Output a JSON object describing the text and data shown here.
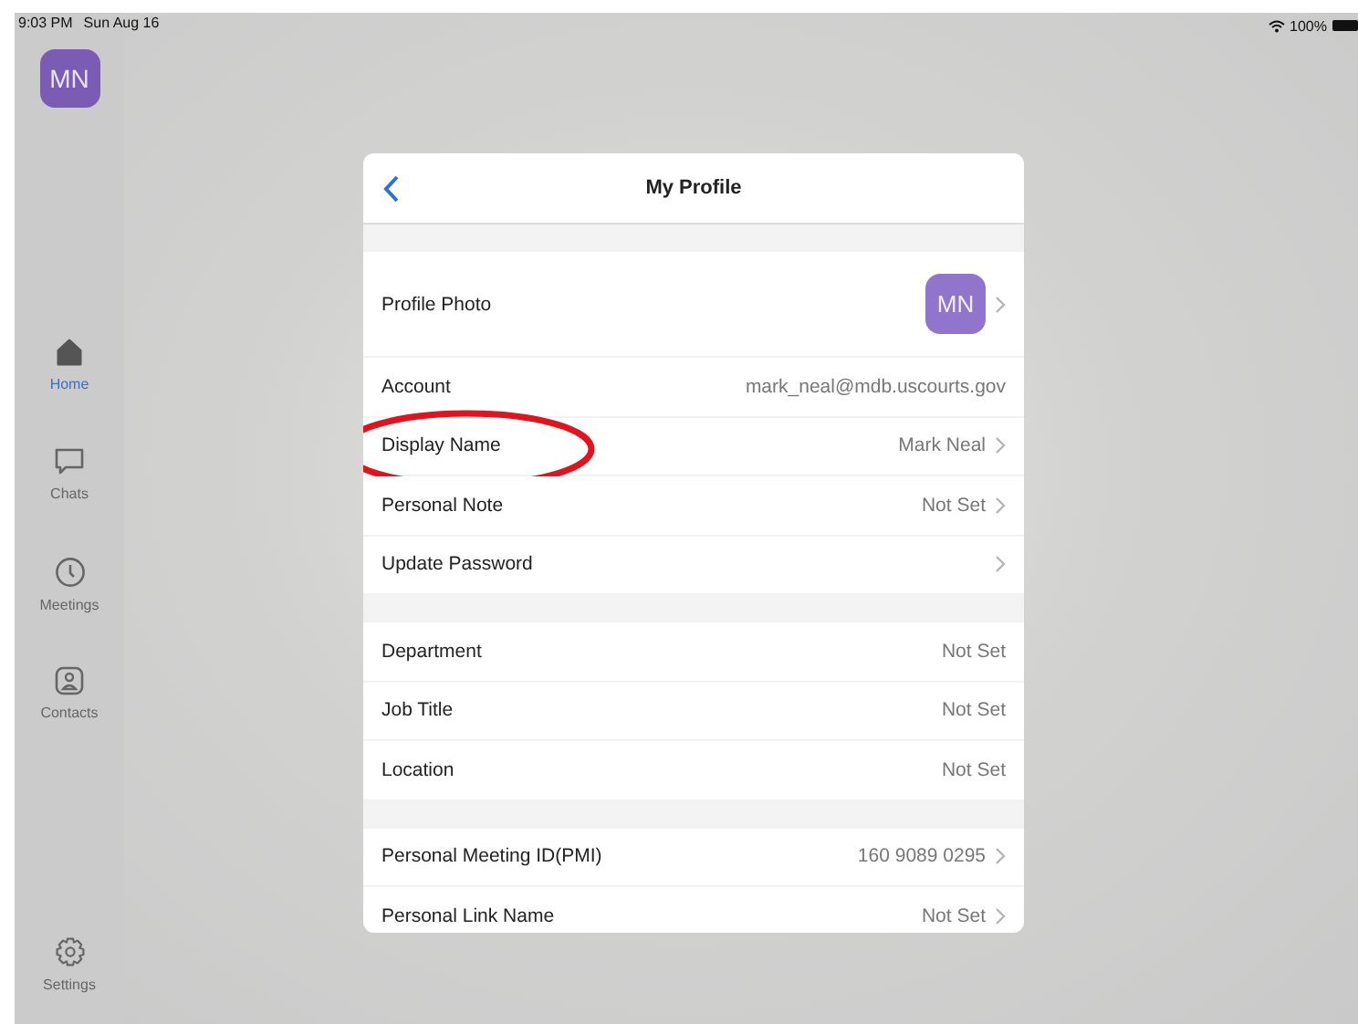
{
  "status_bar": {
    "time": "9:03 PM",
    "date": "Sun Aug 16",
    "battery": "100%"
  },
  "sidebar": {
    "avatar": "MN",
    "items": [
      {
        "label": "Home",
        "selected": true
      },
      {
        "label": "Chats",
        "selected": false
      },
      {
        "label": "Meetings",
        "selected": false
      },
      {
        "label": "Contacts",
        "selected": false
      }
    ],
    "settings": {
      "label": "Settings",
      "selected": false
    }
  },
  "dialog": {
    "title": "My Profile",
    "sections": [
      {
        "rows": [
          {
            "label": "Profile Photo",
            "kind": "avatar",
            "value": "MN",
            "chevron": true,
            "circled": false
          },
          {
            "label": "Account",
            "kind": "text",
            "value": "mark_neal@mdb.uscourts.gov",
            "chevron": false,
            "circled": false
          },
          {
            "label": "Display Name",
            "kind": "text",
            "value": "Mark Neal",
            "chevron": true,
            "circled": true
          },
          {
            "label": "Personal Note",
            "kind": "text",
            "value": "Not Set",
            "chevron": true,
            "circled": false
          },
          {
            "label": "Update Password",
            "kind": "text",
            "chevron": true,
            "circled": false
          }
        ]
      },
      {
        "rows": [
          {
            "label": "Department",
            "kind": "text",
            "value": "Not Set",
            "chevron": false,
            "circled": false
          },
          {
            "label": "Job Title",
            "kind": "text",
            "value": "Not Set",
            "chevron": false,
            "circled": false
          },
          {
            "label": "Location",
            "kind": "text",
            "value": "Not Set",
            "chevron": false,
            "circled": false
          }
        ]
      },
      {
        "rows": [
          {
            "label": "Personal Meeting ID(PMI)",
            "kind": "text",
            "value": "160 9089 0295",
            "chevron": true,
            "circled": false
          },
          {
            "label": "Personal Link Name",
            "kind": "text",
            "value": "Not Set",
            "chevron": true,
            "circled": false
          }
        ]
      }
    ]
  }
}
